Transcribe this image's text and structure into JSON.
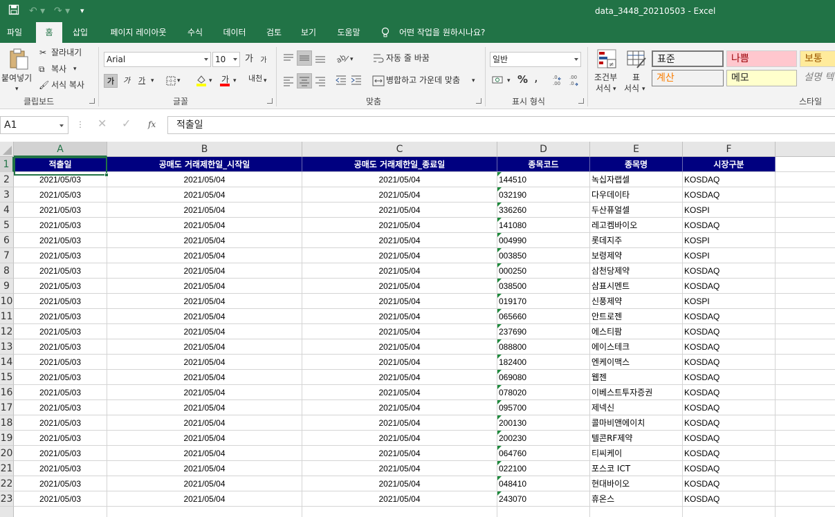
{
  "app": {
    "title": "data_3448_20210503  -  Excel",
    "colors": {
      "brand": "#217346",
      "header_fill": "#000080",
      "text_indicator": "#1e8a3c"
    }
  },
  "tabs": [
    "파일",
    "홈",
    "삽입",
    "페이지 레이아웃",
    "수식",
    "데이터",
    "검토",
    "보기",
    "도움말"
  ],
  "tell_me": "어떤 작업을 원하시나요?",
  "ribbon": {
    "clipboard": {
      "paste": "붙여넣기",
      "cut": "잘라내기",
      "copy": "복사",
      "format_painter": "서식 복사",
      "label": "클립보드"
    },
    "font": {
      "name": "Arial",
      "size": "10",
      "bold": "가",
      "italic": "가",
      "underline": "가",
      "grow": "가",
      "shrink": "가",
      "label": "글꼴",
      "phonetic": "내천"
    },
    "alignment": {
      "wrap": "자동 줄 바꿈",
      "merge": "병합하고 가운데 맞춤",
      "label": "맞춤"
    },
    "number": {
      "format": "일반",
      "label": "표시 형식"
    },
    "styles": {
      "conditional": [
        "조건부",
        "서식"
      ],
      "table": [
        "표",
        "서식"
      ],
      "cells": [
        {
          "label": "표준",
          "bg": "#ffffff",
          "fg": "#000000"
        },
        {
          "label": "나쁨",
          "bg": "#ffc7ce",
          "fg": "#9c0006"
        },
        {
          "label": "보통",
          "bg": "#ffeb9c",
          "fg": "#9c5700"
        },
        {
          "label": "계산",
          "bg": "#f2f2f2",
          "fg": "#fa7d00"
        },
        {
          "label": "메모",
          "bg": "#ffffcc",
          "fg": "#000000"
        },
        {
          "label": "설명 텍",
          "bg": "#f3f3f3",
          "fg": "#7f7f7f"
        }
      ],
      "label": "스타일"
    }
  },
  "formula_bar": {
    "name_box": "A1",
    "fx": "fx",
    "content": "적출일"
  },
  "sheet": {
    "columns": [
      "A",
      "B",
      "C",
      "D",
      "E",
      "F"
    ],
    "headers": [
      "적출일",
      "공매도 거래제한일_시작일",
      "공매도 거래제한일_종료일",
      "종목코드",
      "종목명",
      "시장구분"
    ],
    "rows": [
      [
        "2021/05/03",
        "2021/05/04",
        "2021/05/04",
        "144510",
        "녹십자랩셀",
        "KOSDAQ"
      ],
      [
        "2021/05/03",
        "2021/05/04",
        "2021/05/04",
        "032190",
        "다우데이타",
        "KOSDAQ"
      ],
      [
        "2021/05/03",
        "2021/05/04",
        "2021/05/04",
        "336260",
        "두산퓨얼셀",
        "KOSPI"
      ],
      [
        "2021/05/03",
        "2021/05/04",
        "2021/05/04",
        "141080",
        "레고켐바이오",
        "KOSDAQ"
      ],
      [
        "2021/05/03",
        "2021/05/04",
        "2021/05/04",
        "004990",
        "롯데지주",
        "KOSPI"
      ],
      [
        "2021/05/03",
        "2021/05/04",
        "2021/05/04",
        "003850",
        "보령제약",
        "KOSPI"
      ],
      [
        "2021/05/03",
        "2021/05/04",
        "2021/05/04",
        "000250",
        "삼천당제약",
        "KOSDAQ"
      ],
      [
        "2021/05/03",
        "2021/05/04",
        "2021/05/04",
        "038500",
        "삼표시멘트",
        "KOSDAQ"
      ],
      [
        "2021/05/03",
        "2021/05/04",
        "2021/05/04",
        "019170",
        "신풍제약",
        "KOSPI"
      ],
      [
        "2021/05/03",
        "2021/05/04",
        "2021/05/04",
        "065660",
        "안트로젠",
        "KOSDAQ"
      ],
      [
        "2021/05/03",
        "2021/05/04",
        "2021/05/04",
        "237690",
        "에스티팜",
        "KOSDAQ"
      ],
      [
        "2021/05/03",
        "2021/05/04",
        "2021/05/04",
        "088800",
        "에이스테크",
        "KOSDAQ"
      ],
      [
        "2021/05/03",
        "2021/05/04",
        "2021/05/04",
        "182400",
        "엔케이맥스",
        "KOSDAQ"
      ],
      [
        "2021/05/03",
        "2021/05/04",
        "2021/05/04",
        "069080",
        "웹젠",
        "KOSDAQ"
      ],
      [
        "2021/05/03",
        "2021/05/04",
        "2021/05/04",
        "078020",
        "이베스트투자증권",
        "KOSDAQ"
      ],
      [
        "2021/05/03",
        "2021/05/04",
        "2021/05/04",
        "095700",
        "제넥신",
        "KOSDAQ"
      ],
      [
        "2021/05/03",
        "2021/05/04",
        "2021/05/04",
        "200130",
        "콜마비앤에이치",
        "KOSDAQ"
      ],
      [
        "2021/05/03",
        "2021/05/04",
        "2021/05/04",
        "200230",
        "텔콘RF제약",
        "KOSDAQ"
      ],
      [
        "2021/05/03",
        "2021/05/04",
        "2021/05/04",
        "064760",
        "티씨케이",
        "KOSDAQ"
      ],
      [
        "2021/05/03",
        "2021/05/04",
        "2021/05/04",
        "022100",
        "포스코 ICT",
        "KOSDAQ"
      ],
      [
        "2021/05/03",
        "2021/05/04",
        "2021/05/04",
        "048410",
        "현대바이오",
        "KOSDAQ"
      ],
      [
        "2021/05/03",
        "2021/05/04",
        "2021/05/04",
        "243070",
        "휴온스",
        "KOSDAQ"
      ]
    ]
  }
}
